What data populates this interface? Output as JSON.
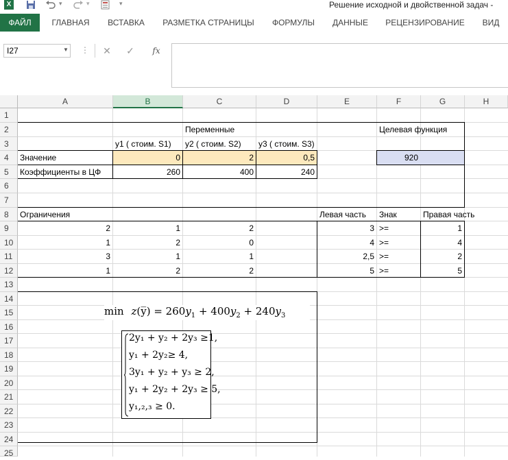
{
  "window": {
    "title": "Решение исходной и двойственной задач -",
    "qat": {
      "excel_logo": "X",
      "save_icon": "save-icon",
      "undo_icon": "undo-icon",
      "redo_icon": "redo-icon"
    }
  },
  "ribbon": {
    "tabs": [
      {
        "label": "ФАЙЛ"
      },
      {
        "label": "ГЛАВНАЯ"
      },
      {
        "label": "ВСТАВКА"
      },
      {
        "label": "РАЗМЕТКА СТРАНИЦЫ"
      },
      {
        "label": "ФОРМУЛЫ"
      },
      {
        "label": "ДАННЫЕ"
      },
      {
        "label": "РЕЦЕНЗИРОВАНИЕ"
      },
      {
        "label": "ВИД"
      }
    ]
  },
  "formula_bar": {
    "name_box": "I27",
    "cancel": "✕",
    "enter": "✓",
    "fx": "fx",
    "value": ""
  },
  "columns": [
    "A",
    "B",
    "C",
    "D",
    "E",
    "F",
    "G",
    "H"
  ],
  "selected_column": "B",
  "rows": [
    "1",
    "2",
    "3",
    "4",
    "5",
    "6",
    "7",
    "8",
    "9",
    "10",
    "11",
    "12",
    "13",
    "14",
    "15",
    "16",
    "17",
    "18",
    "19",
    "20",
    "21",
    "22",
    "23",
    "24",
    "25"
  ],
  "sheet": {
    "variables_header": "Переменные",
    "objective_header": "Целевая функция",
    "y1_label": "y1 ( стоим. S1)",
    "y2_label": "y2 ( стоим. S2)",
    "y3_label": "y3 ( стоим. S3)",
    "value_label": "Значение",
    "y1_value": "0",
    "y2_value": "2",
    "y3_value": "0,5",
    "objective_value": "920",
    "coef_label": "Коэффициенты в ЦФ",
    "c1": "260",
    "c2": "400",
    "c3": "240",
    "constraints_label": "Ограничения",
    "lhs_label": "Левая часть",
    "sign_label": "Знак",
    "rhs_label": "Правая часть",
    "constraints": [
      {
        "a": "2",
        "b": "1",
        "c": "2",
        "lhs": "3",
        "sign": ">=",
        "rhs": "1"
      },
      {
        "a": "1",
        "b": "2",
        "c": "0",
        "lhs": "4",
        "sign": ">=",
        "rhs": "4"
      },
      {
        "a": "3",
        "b": "1",
        "c": "1",
        "lhs": "2,5",
        "sign": ">=",
        "rhs": "2"
      },
      {
        "a": "1",
        "b": "2",
        "c": "2",
        "lhs": "5",
        "sign": ">=",
        "rhs": "5"
      }
    ]
  },
  "math": {
    "objective": {
      "min": "min",
      "z": "z",
      "ybar": "(y̅)",
      "eq": " = 260",
      "y1": "y",
      "s1": "1",
      "p2": " + 400",
      "y2": "y",
      "s2": "2",
      "p3": " + 240",
      "y3": "y",
      "s3": "3"
    },
    "system": [
      "2y₁ + y₂ + 2y₃ ≥1,",
      "y₁ + 2y₂≥ 4,",
      "3y₁ + y₂ + y₃ ≥ 2,",
      "y₁ + 2y₂ + 2y₃ ≥ 5,",
      "y₁,₂,₃ ≥ 0."
    ]
  }
}
